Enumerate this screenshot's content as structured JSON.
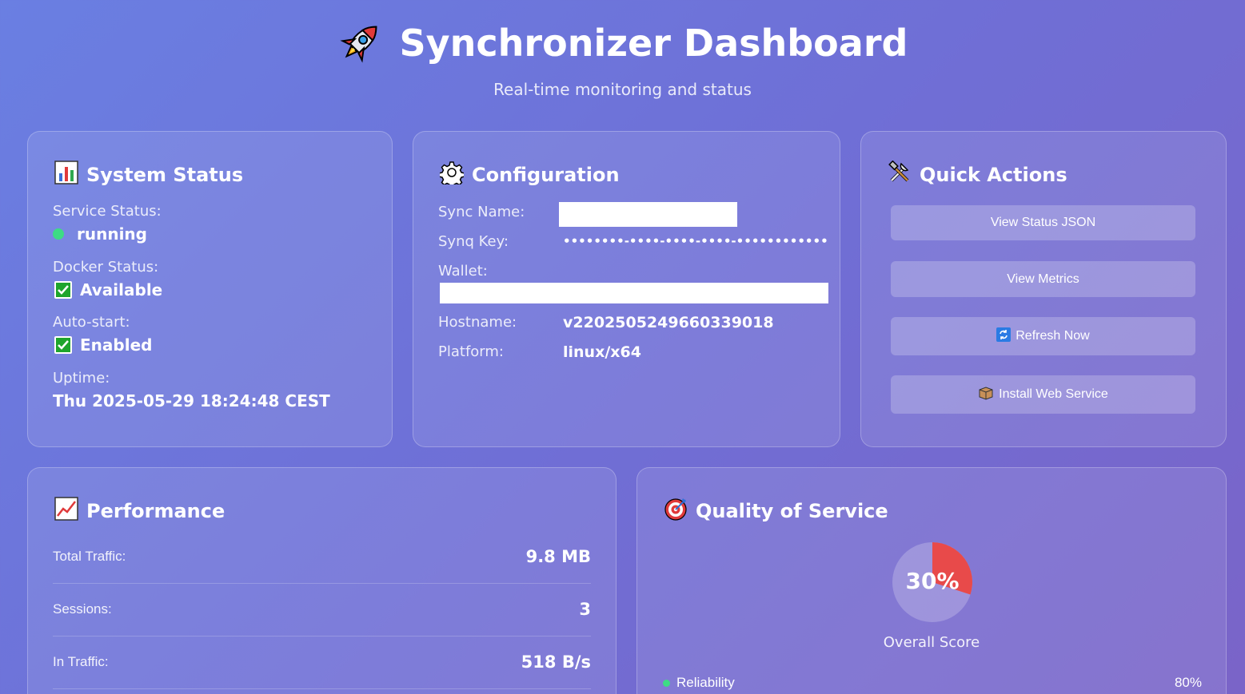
{
  "header": {
    "title": "Synchronizer Dashboard",
    "subtitle": "Real-time monitoring and status",
    "icon": "rocket-icon"
  },
  "system_status": {
    "title": "System Status",
    "icon": "bar-chart-icon",
    "service_status_label": "Service Status:",
    "service_status_value": "running",
    "service_status_color": "#3ddc84",
    "docker_status_label": "Docker Status:",
    "docker_status_value": "Available",
    "autostart_label": "Auto-start:",
    "autostart_value": "Enabled",
    "uptime_label": "Uptime:",
    "uptime_value": "Thu 2025-05-29 18:24:48 CEST"
  },
  "configuration": {
    "title": "Configuration",
    "icon": "gear-icon",
    "sync_name_label": "Sync Name:",
    "synq_key_label": "Synq Key:",
    "synq_key_value": "••••••••-••••-••••-••••-••••••••••••",
    "wallet_label": "Wallet:",
    "hostname_label": "Hostname:",
    "hostname_value": "v2202505249660339018",
    "platform_label": "Platform:",
    "platform_value": "linux/x64"
  },
  "quick_actions": {
    "title": "Quick Actions",
    "icon": "tools-icon",
    "buttons": {
      "view_status_json": "View Status JSON",
      "view_metrics": "View Metrics",
      "refresh_now": "Refresh Now",
      "install_web_service": "Install Web Service"
    }
  },
  "performance": {
    "title": "Performance",
    "icon": "chart-increasing-icon",
    "rows": [
      {
        "label": "Total Traffic:",
        "value": "9.8 MB"
      },
      {
        "label": "Sessions:",
        "value": "3"
      },
      {
        "label": "In Traffic:",
        "value": "518 B/s"
      }
    ]
  },
  "quality_of_service": {
    "title": "Quality of Service",
    "icon": "target-icon",
    "overall_score": 30,
    "overall_score_text": "30%",
    "overall_label": "Overall Score",
    "score_color": "#e84a4a",
    "reliability_label": "Reliability",
    "reliability_value": "80%",
    "reliability_color": "#3ddc84"
  }
}
